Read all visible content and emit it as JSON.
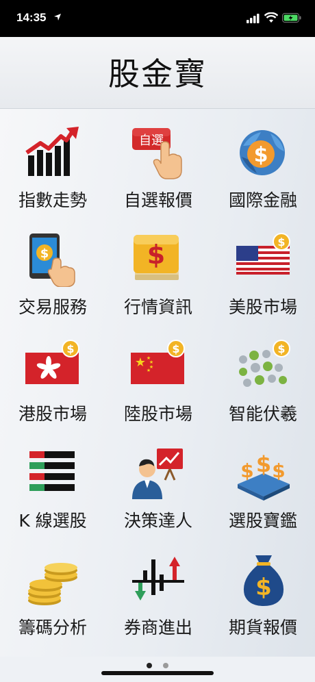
{
  "status": {
    "time": "14:35"
  },
  "app": {
    "title": "股金寶"
  },
  "menu": [
    {
      "label": "指數走勢",
      "icon": "trend-chart-icon"
    },
    {
      "label": "自選報價",
      "icon": "watchlist-tap-icon",
      "badge": "自選"
    },
    {
      "label": "國際金融",
      "icon": "globe-dollar-icon"
    },
    {
      "label": "交易服務",
      "icon": "tablet-trade-icon"
    },
    {
      "label": "行情資訊",
      "icon": "dollar-book-icon"
    },
    {
      "label": "美股市場",
      "icon": "us-flag-icon"
    },
    {
      "label": "港股市場",
      "icon": "hk-flag-icon"
    },
    {
      "label": "陸股市場",
      "icon": "cn-flag-icon"
    },
    {
      "label": "智能伏羲",
      "icon": "dot-grid-icon"
    },
    {
      "label": "K 線選股",
      "icon": "k-line-icon"
    },
    {
      "label": "決策達人",
      "icon": "presenter-icon"
    },
    {
      "label": "選股寶鑑",
      "icon": "dollar-signs-icon"
    },
    {
      "label": "籌碼分析",
      "icon": "coin-stack-icon"
    },
    {
      "label": "券商進出",
      "icon": "broker-arrows-icon"
    },
    {
      "label": "期貨報價",
      "icon": "money-bag-icon"
    }
  ],
  "pager": {
    "pages": 2,
    "current": 1
  },
  "colors": {
    "dot_active": "#222222",
    "dot_inactive": "#9a9a9a"
  }
}
